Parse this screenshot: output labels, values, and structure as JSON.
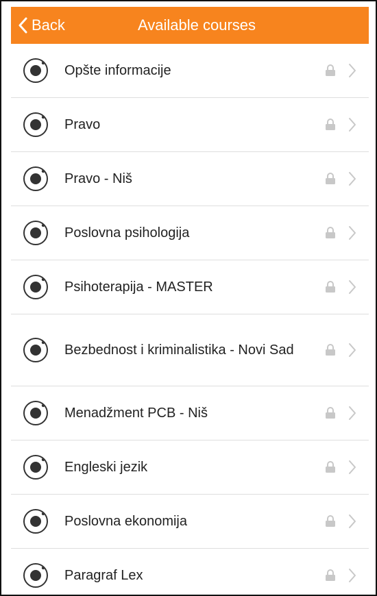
{
  "header": {
    "back_label": "Back",
    "title": "Available courses"
  },
  "colors": {
    "accent": "#f7841e",
    "icon": "#333333",
    "muted": "#c8c8c8"
  },
  "courses": [
    {
      "label": "Opšte informacije"
    },
    {
      "label": "Pravo"
    },
    {
      "label": "Pravo - Niš"
    },
    {
      "label": "Poslovna psihologija"
    },
    {
      "label": "Psihoterapija - MASTER"
    },
    {
      "label": "Bezbednost i kriminalistika - Novi Sad"
    },
    {
      "label": "Menadžment PCB - Niš"
    },
    {
      "label": "Engleski jezik"
    },
    {
      "label": "Poslovna ekonomija"
    },
    {
      "label": "Paragraf Lex"
    }
  ]
}
